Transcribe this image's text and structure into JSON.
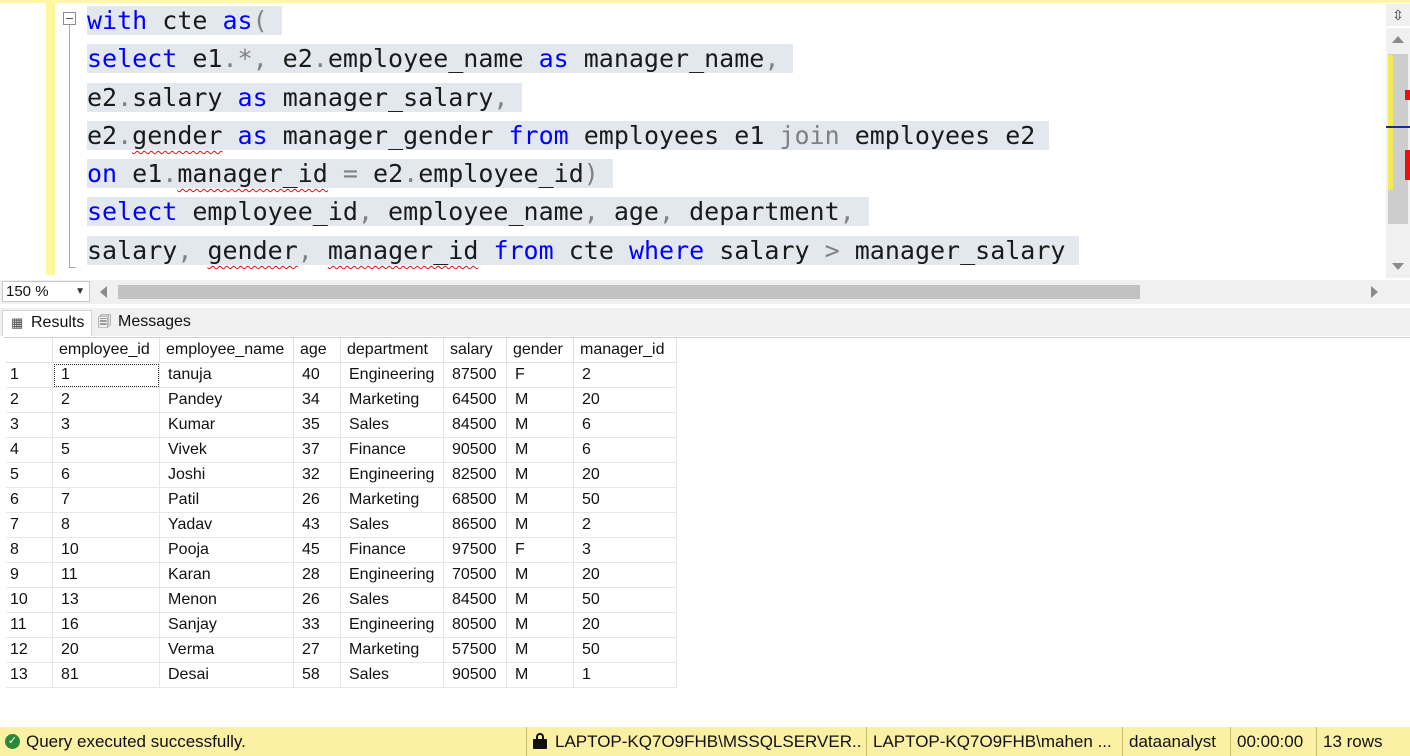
{
  "editor": {
    "lines": [
      [
        {
          "t": "with",
          "c": "kw"
        },
        {
          "t": " cte "
        },
        {
          "t": "as",
          "c": "kw"
        },
        {
          "t": "(",
          "c": "op"
        }
      ],
      [
        {
          "t": "select",
          "c": "kw"
        },
        {
          "t": " e1"
        },
        {
          "t": ".*,",
          "c": "op"
        },
        {
          "t": " e2"
        },
        {
          "t": ".",
          "c": "op"
        },
        {
          "t": "employee_name "
        },
        {
          "t": "as",
          "c": "kw"
        },
        {
          "t": " manager_name"
        },
        {
          "t": ",",
          "c": "op"
        }
      ],
      [
        {
          "t": "e2"
        },
        {
          "t": ".",
          "c": "op"
        },
        {
          "t": "salary "
        },
        {
          "t": "as",
          "c": "kw"
        },
        {
          "t": " manager_salary"
        },
        {
          "t": ",",
          "c": "op"
        }
      ],
      [
        {
          "t": "e2"
        },
        {
          "t": ".",
          "c": "op"
        },
        {
          "t": "gender",
          "c": "err"
        },
        {
          "t": " "
        },
        {
          "t": "as",
          "c": "kw"
        },
        {
          "t": " manager_gender "
        },
        {
          "t": "from",
          "c": "kw"
        },
        {
          "t": " employees e1 "
        },
        {
          "t": "join",
          "c": "op"
        },
        {
          "t": " employees e2"
        }
      ],
      [
        {
          "t": "on",
          "c": "kw"
        },
        {
          "t": " e1"
        },
        {
          "t": ".",
          "c": "op"
        },
        {
          "t": "manager_id",
          "c": "err"
        },
        {
          "t": " "
        },
        {
          "t": "=",
          "c": "op"
        },
        {
          "t": " e2"
        },
        {
          "t": ".",
          "c": "op"
        },
        {
          "t": "employee_id"
        },
        {
          "t": ")",
          "c": "op"
        }
      ],
      [
        {
          "t": "select",
          "c": "kw"
        },
        {
          "t": " employee_id"
        },
        {
          "t": ",",
          "c": "op"
        },
        {
          "t": " employee_name"
        },
        {
          "t": ",",
          "c": "op"
        },
        {
          "t": " age"
        },
        {
          "t": ",",
          "c": "op"
        },
        {
          "t": " department"
        },
        {
          "t": ",",
          "c": "op"
        }
      ],
      [
        {
          "t": "salary"
        },
        {
          "t": ",",
          "c": "op"
        },
        {
          "t": " "
        },
        {
          "t": "gender",
          "c": "err"
        },
        {
          "t": ",",
          "c": "op"
        },
        {
          "t": " "
        },
        {
          "t": "manager_id",
          "c": "err"
        },
        {
          "t": " "
        },
        {
          "t": "from",
          "c": "kw"
        },
        {
          "t": " cte "
        },
        {
          "t": "where",
          "c": "kw"
        },
        {
          "t": " salary "
        },
        {
          "t": ">",
          "c": "op"
        },
        {
          "t": " manager_salary"
        }
      ]
    ]
  },
  "zoom": {
    "value": "150 %"
  },
  "tabs": {
    "results": "Results",
    "messages": "Messages"
  },
  "grid": {
    "columns": [
      "employee_id",
      "employee_name",
      "age",
      "department",
      "salary",
      "gender",
      "manager_id"
    ],
    "rows": [
      [
        "1",
        "1",
        "tanuja",
        "40",
        "Engineering",
        "87500",
        "F",
        "2"
      ],
      [
        "2",
        "2",
        "Pandey",
        "34",
        "Marketing",
        "64500",
        "M",
        "20"
      ],
      [
        "3",
        "3",
        "Kumar",
        "35",
        "Sales",
        "84500",
        "M",
        "6"
      ],
      [
        "4",
        "5",
        "Vivek",
        "37",
        "Finance",
        "90500",
        "M",
        "6"
      ],
      [
        "5",
        "6",
        "Joshi",
        "32",
        "Engineering",
        "82500",
        "M",
        "20"
      ],
      [
        "6",
        "7",
        "Patil",
        "26",
        "Marketing",
        "68500",
        "M",
        "50"
      ],
      [
        "7",
        "8",
        "Yadav",
        "43",
        "Sales",
        "86500",
        "M",
        "2"
      ],
      [
        "8",
        "10",
        "Pooja",
        "45",
        "Finance",
        "97500",
        "F",
        "3"
      ],
      [
        "9",
        "11",
        "Karan",
        "28",
        "Engineering",
        "70500",
        "M",
        "20"
      ],
      [
        "10",
        "13",
        "Menon",
        "26",
        "Sales",
        "84500",
        "M",
        "50"
      ],
      [
        "11",
        "16",
        "Sanjay",
        "33",
        "Engineering",
        "80500",
        "M",
        "20"
      ],
      [
        "12",
        "20",
        "Verma",
        "27",
        "Marketing",
        "57500",
        "M",
        "50"
      ],
      [
        "13",
        "81",
        "Desai",
        "58",
        "Sales",
        "90500",
        "M",
        "1"
      ]
    ]
  },
  "status": {
    "message": "Query executed successfully.",
    "server": "LAPTOP-KQ7O9FHB\\MSSQLSERVER...",
    "user": "LAPTOP-KQ7O9FHB\\mahen ...",
    "database": "dataanalyst",
    "elapsed": "00:00:00",
    "rows": "13 rows"
  }
}
